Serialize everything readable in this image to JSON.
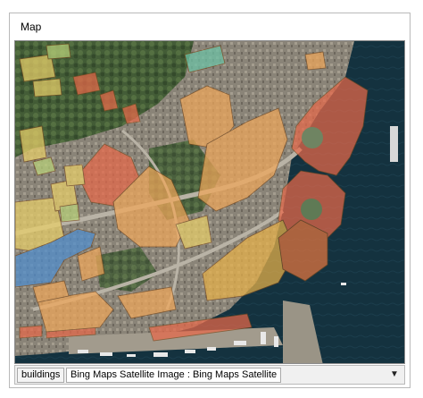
{
  "window": {
    "title": "Map"
  },
  "status_bar": {
    "layer_label": "buildings",
    "basemap_label": "Bing Maps Satellite Image : Bing Maps Satellite",
    "dropdown_icon": "chevron-down-icon"
  },
  "colors": {
    "building_orange": "#f0a75a",
    "building_red": "#e8694a",
    "building_yellow": "#e9d06a",
    "building_blue": "#4f8fd0",
    "sea": "#13303f"
  }
}
